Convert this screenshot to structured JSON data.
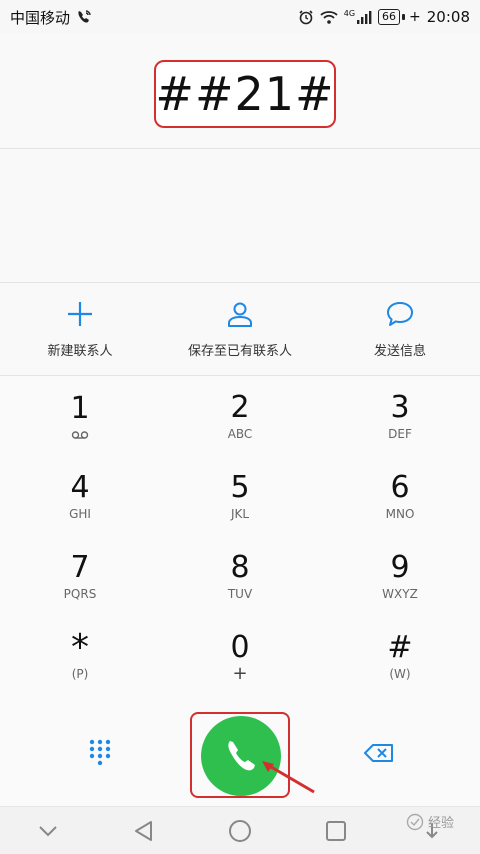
{
  "status_bar": {
    "carrier": "中国移动",
    "signal_label": "4G",
    "battery": "66",
    "time": "20:08"
  },
  "dialer": {
    "number": "##21#"
  },
  "actions": [
    {
      "label": "新建联系人",
      "icon": "plus-icon"
    },
    {
      "label": "保存至已有联系人",
      "icon": "person-icon"
    },
    {
      "label": "发送信息",
      "icon": "chat-bubble-icon"
    }
  ],
  "keypad": [
    {
      "digit": "1",
      "letters": "",
      "icon": "voicemail-icon"
    },
    {
      "digit": "2",
      "letters": "ABC"
    },
    {
      "digit": "3",
      "letters": "DEF"
    },
    {
      "digit": "4",
      "letters": "GHI"
    },
    {
      "digit": "5",
      "letters": "JKL"
    },
    {
      "digit": "6",
      "letters": "MNO"
    },
    {
      "digit": "7",
      "letters": "PQRS"
    },
    {
      "digit": "8",
      "letters": "TUV"
    },
    {
      "digit": "9",
      "letters": "WXYZ"
    },
    {
      "digit": "*",
      "letters": "(P)"
    },
    {
      "digit": "0",
      "letters": "+"
    },
    {
      "digit": "#",
      "letters": "(W)"
    }
  ],
  "colors": {
    "accent": "#1e88e5",
    "call": "#2fbf4f",
    "highlight": "#d32f2f"
  },
  "watermark": "经验"
}
